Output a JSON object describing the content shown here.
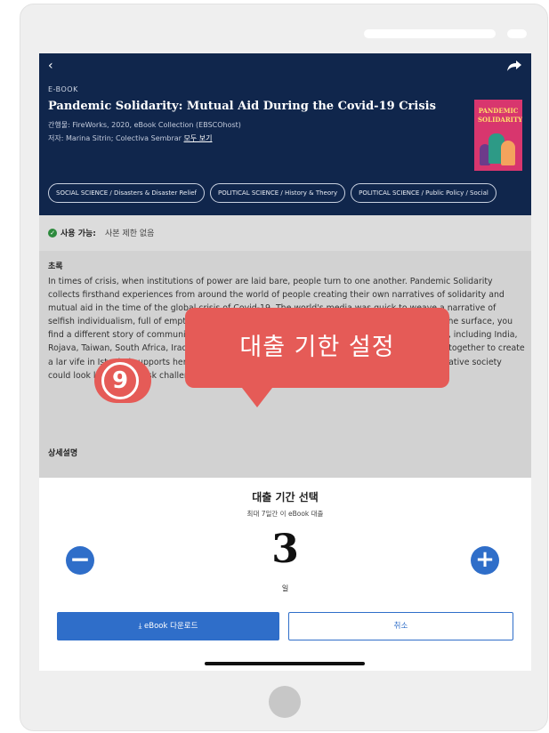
{
  "header": {
    "back_icon": "chevron-left-icon",
    "share_icon": "share-arrow-icon",
    "type_label": "E-BOOK",
    "title": "Pandemic Solidarity: Mutual Aid During the Covid-19 Crisis",
    "publisher": "간행물: FireWorks, 2020, eBook Collection (EBSCOhost)",
    "authors_prefix": "저자: Marina Sitrin; Colectiva Sembrar ",
    "authors_link": "모두 보기",
    "cover_text": "PANDEMIC SOLIDARITY",
    "chips": [
      "SOCIAL SCIENCE / Disasters & Disaster Relief",
      "POLITICAL SCIENCE / History & Theory",
      "POLITICAL SCIENCE / Public Policy / Social"
    ],
    "bg_color": "#10264c"
  },
  "availability": {
    "label": "사용 가능:",
    "value": "사본 제한 없음"
  },
  "abstract": {
    "heading": "초록",
    "text": "In times of crisis, when institutions of power are laid bare, people turn to one another. Pandemic Solidarity collects firsthand experiences from around the world of people creating their own narratives of solidarity and mutual aid in the time of the global crisis of Covid-19. The world's media was quick to weave a narrative of selfish individualism, full of empty supermarket shelves and con-men. However, if you scratch the surface, you find a different story of community and self-sacrifice. Looking at eighteen countries and regions, including India, Rojava, Taiwan, South Africa, Iraq and North America, the personal accounts in the book weave together to create a lar                    vife in Istanbul supports her neighbour in the                                                 a disability activist in South Korea does. M                                                  rnative society could look like          flect the sk challenging institut              r that ha"
  },
  "detail_heading": "상세설명",
  "tooltip": {
    "text": "대출 기한 설정",
    "step": "9",
    "color": "#e55b57"
  },
  "sheet": {
    "title": "대출 기간 선택",
    "subtitle": "최대 7일간 이 eBook 대출",
    "days": "3",
    "unit": "일",
    "minus_symbol": "−",
    "plus_symbol": "+",
    "download_label": "⤓ eBook 다운로드",
    "cancel_label": "취소",
    "accent": "#2f6ec9"
  }
}
